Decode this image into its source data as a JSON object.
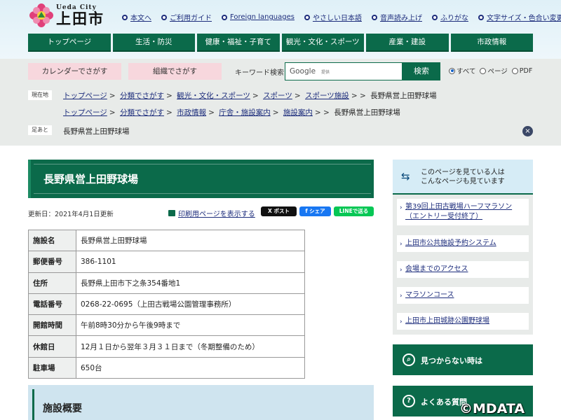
{
  "header": {
    "logo_city": "Ueda City",
    "logo_name": "上田市",
    "top_links": [
      "本文へ",
      "ご利用ガイド",
      "Foreign languages",
      "やさしい日本語",
      "音声読み上げ",
      "ふりがな",
      "文字サイズ・色合い変更"
    ],
    "gnav": [
      "トップページ",
      "生活・防災",
      "健康・福祉・子育て",
      "観光・文化・スポーツ",
      "産業・建設",
      "市政情報"
    ]
  },
  "search": {
    "calendar_label": "カレンダーでさがす",
    "org_label": "組織でさがす",
    "keyword_label": "キーワード検索",
    "google_label": "Google",
    "google_sub": "提供",
    "button_label": "検索",
    "options": [
      "すべて",
      "ページ",
      "PDF"
    ],
    "selected_option": "すべて"
  },
  "breadcrumbs": {
    "tag_current": "現在地",
    "tag_trail": "足あと",
    "line1": [
      "トップページ",
      "分類でさがす",
      "観光・文化・スポーツ",
      "スポーツ",
      "スポーツ施設"
    ],
    "line1_current": "長野県営上田野球場",
    "line2": [
      "トップページ",
      "分類でさがす",
      "市政情報",
      "庁舎・施設案内",
      "施設案内"
    ],
    "line2_current": "長野県営上田野球場",
    "trail": "長野県営上田野球場",
    "close_symbol": "×"
  },
  "main": {
    "title": "長野県営上田野球場",
    "updated": "更新日：2021年4月1日更新",
    "print_label": "印刷用ページを表示する",
    "sns": {
      "x": "X ポスト",
      "facebook": "f シェア",
      "line": "LINEで送る"
    },
    "table": [
      {
        "label": "施設名",
        "value": "長野県営上田野球場"
      },
      {
        "label": "郵便番号",
        "value": "386-1101"
      },
      {
        "label": "住所",
        "value": "長野県上田市下之条354番地1"
      },
      {
        "label": "電話番号",
        "value": "0268-22-0695（上田古戦場公園管理事務所）"
      },
      {
        "label": "開館時間",
        "value": "午前8時30分から午後9時まで"
      },
      {
        "label": "休館日",
        "value": "12月１日から翌年３月３１日まで（冬期整備のため）"
      },
      {
        "label": "駐車場",
        "value": "650台"
      }
    ],
    "section_title": "施設概要"
  },
  "sidebar": {
    "head_line1": "このページを見ている人は",
    "head_line2": "こんなページも見ています",
    "items": [
      "第39回上田古戦場ハーフマラソン（エントリー受付終了）",
      "上田市公共施設予約システム",
      "会場までのアクセス",
      "マラソンコース",
      "上田市上田城跡公園野球場"
    ],
    "not_found": "見つからない時は",
    "faq": "よくある質問"
  },
  "watermark": "©MDATA",
  "colors": {
    "primary_green": "#0b6a4a",
    "link_navy": "#1d2d7c",
    "pink": "#f7d7dd"
  }
}
